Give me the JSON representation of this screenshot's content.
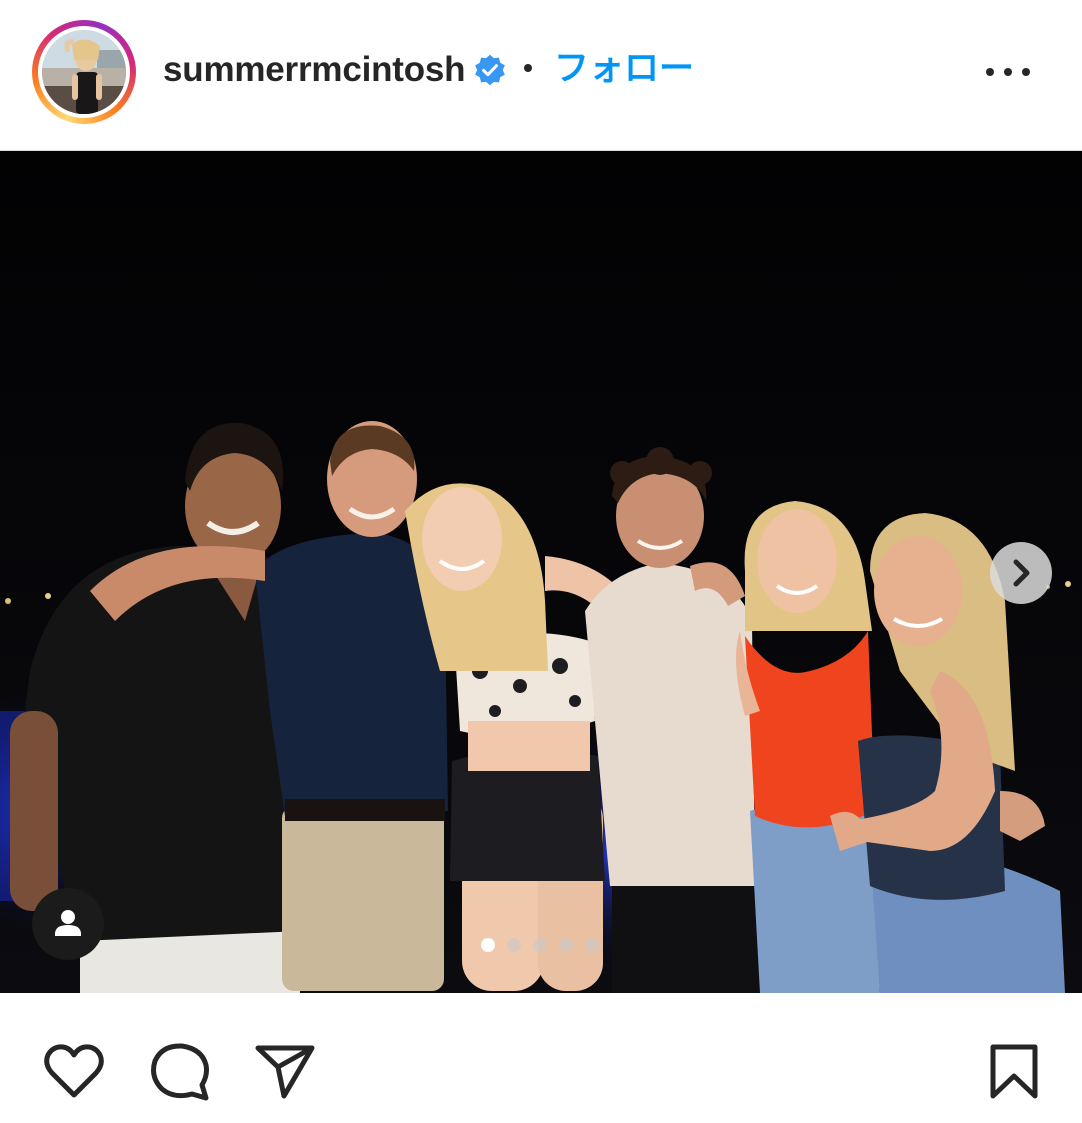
{
  "post": {
    "username": "summerrmcintosh",
    "verified": true,
    "separator": "•",
    "follow_label": "フォロー",
    "more_icon": "more-horizontal-icon"
  },
  "carousel": {
    "total": 5,
    "active_index": 0
  },
  "colors": {
    "follow_blue": "#0095f6",
    "verified_blue": "#3897f0",
    "text": "#262626"
  },
  "actions": {
    "like_icon": "heart-icon",
    "comment_icon": "comment-icon",
    "share_icon": "send-icon",
    "save_icon": "bookmark-icon"
  }
}
